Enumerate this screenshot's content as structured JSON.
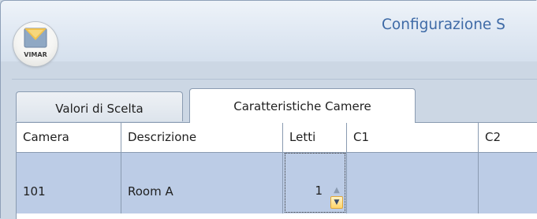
{
  "window": {
    "title": "Configurazione S",
    "logo": {
      "brand": "VIMAR",
      "icon": "vimar-logo-icon",
      "color_top": "#f1c24e",
      "color_bottom": "#8fa8c4"
    }
  },
  "tabs": [
    {
      "label": "Valori di Scelta",
      "active": false
    },
    {
      "label": "Caratteristiche Camere",
      "active": true
    }
  ],
  "grid": {
    "columns": [
      "Camera",
      "Descrizione",
      "Letti",
      "C1",
      "C2"
    ],
    "rows": [
      {
        "camera": "101",
        "descrizione": "Room A",
        "letti": "1",
        "c1": "",
        "c2": ""
      }
    ],
    "selected_row_index": 0,
    "editor": {
      "column": "Letti",
      "value": "1",
      "spin_up": "up-arrow-icon",
      "spin_down": "down-arrow-icon"
    }
  },
  "colors": {
    "title": "#3e6aa6",
    "selection": "#bccce6",
    "grid_line": "#8a9bb1",
    "spin_active": "#ffd46a"
  }
}
